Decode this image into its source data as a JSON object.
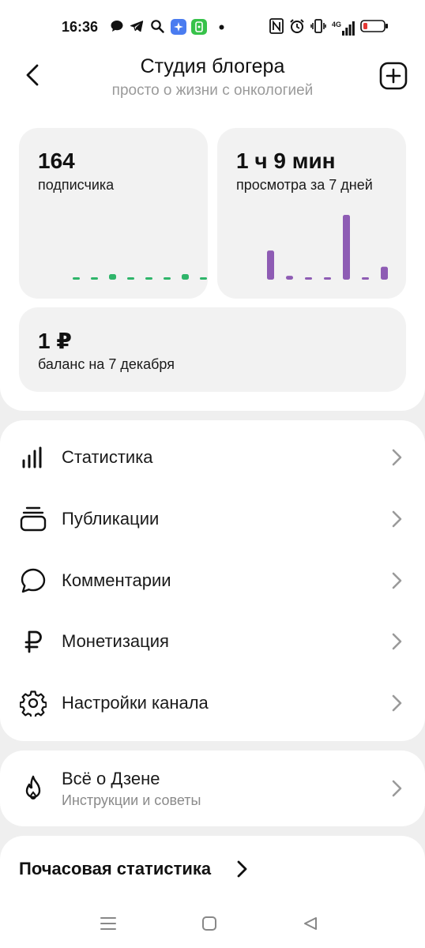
{
  "status_bar": {
    "time": "16:36",
    "left_icons": [
      "chat-bubble-icon",
      "telegram-icon",
      "search-icon",
      "sparkle-app-icon",
      "green-app-icon",
      "dot-icon"
    ],
    "right_icons": [
      "nfc-icon",
      "alarm-icon",
      "vibrate-icon",
      "signal-4g-icon",
      "battery-low-icon"
    ],
    "network": "4G",
    "battery_color": "#e53935"
  },
  "header": {
    "title": "Студия блогера",
    "subtitle": "просто о жизни с онкологией",
    "back_icon": "chevron-left-icon",
    "add_icon": "plus-square-icon"
  },
  "stats": {
    "subscribers": {
      "value": "164",
      "label": "подписчика",
      "color": "#2fb56a",
      "bars": [
        0,
        0,
        1,
        0,
        0,
        0,
        1,
        0
      ]
    },
    "views": {
      "value": "1 ч 9 мин",
      "label": "просмотра за 7 дней",
      "color": "#8e5cb4",
      "bars": [
        0.45,
        0.06,
        0,
        0,
        1,
        0,
        0.2
      ]
    },
    "balance": {
      "value": "1 ₽",
      "label": "баланс на 7 декабря"
    }
  },
  "menu": {
    "items": [
      {
        "label": "Статистика",
        "icon": "bar-chart-icon"
      },
      {
        "label": "Публикации",
        "icon": "stack-icon"
      },
      {
        "label": "Комментарии",
        "icon": "comment-icon"
      },
      {
        "label": "Монетизация",
        "icon": "ruble-icon"
      },
      {
        "label": "Настройки канала",
        "icon": "gear-icon"
      }
    ]
  },
  "about": {
    "title": "Всё о Дзене",
    "subtitle": "Инструкции и советы",
    "icon": "flame-icon"
  },
  "hourly": {
    "title": "Почасовая статистика"
  },
  "nav": {
    "icons": [
      "menu-icon",
      "home-square-icon",
      "back-triangle-icon"
    ]
  }
}
